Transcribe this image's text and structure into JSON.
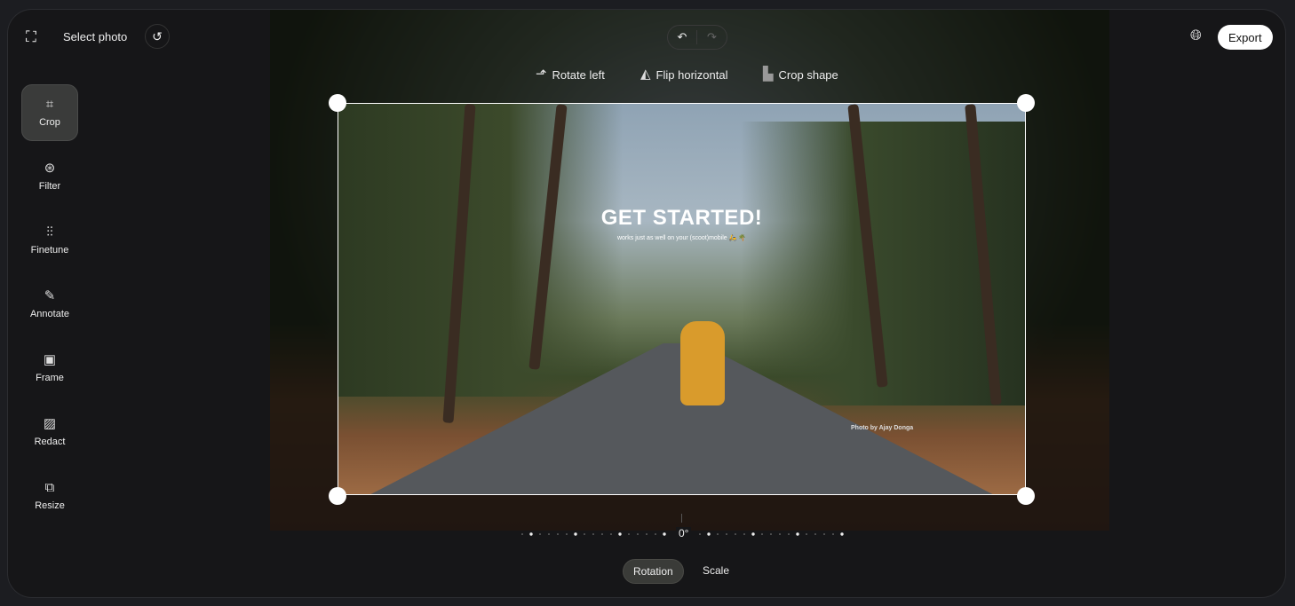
{
  "header": {
    "select_photo": "Select photo",
    "export": "Export"
  },
  "sidebar": {
    "items": [
      {
        "label": "Crop",
        "icon": "crop-icon",
        "active": true
      },
      {
        "label": "Filter",
        "icon": "filter-icon"
      },
      {
        "label": "Finetune",
        "icon": "sliders-icon"
      },
      {
        "label": "Annotate",
        "icon": "pencil-icon"
      },
      {
        "label": "Frame",
        "icon": "frame-icon"
      },
      {
        "label": "Redact",
        "icon": "redact-icon"
      },
      {
        "label": "Resize",
        "icon": "resize-icon"
      }
    ]
  },
  "toolbar": {
    "rotate_left": "Rotate left",
    "flip_horizontal": "Flip horizontal",
    "crop_shape": "Crop shape"
  },
  "photo": {
    "title": "GET STARTED!",
    "subtitle": "works just as well on your (scoot)mobile 🛵 🌴",
    "credit": "Photo by Ajay Donga"
  },
  "rotation": {
    "value": "0°"
  },
  "tabs": [
    {
      "label": "Rotation",
      "active": true
    },
    {
      "label": "Scale"
    }
  ]
}
